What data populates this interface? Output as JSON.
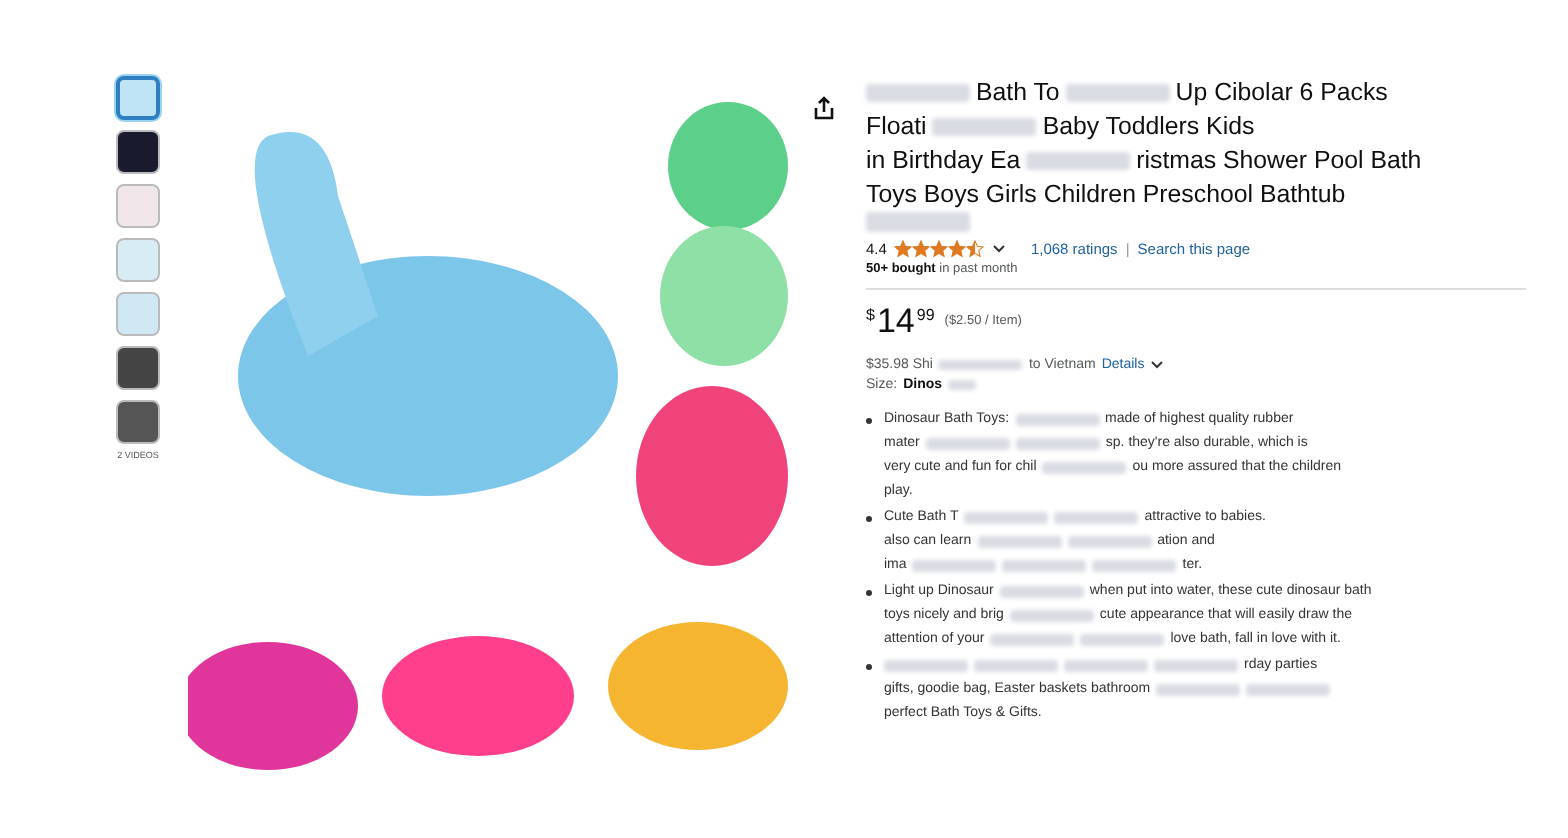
{
  "thumbnails": [
    {
      "selected": true
    },
    {
      "selected": false
    },
    {
      "selected": false
    },
    {
      "selected": false
    },
    {
      "selected": false
    },
    {
      "selected": false
    },
    {
      "selected": false
    }
  ],
  "videos_label": "2 VIDEOS",
  "title_lines": [
    [
      {
        "kind": "redacted"
      },
      {
        "kind": "text",
        "text": "Bath To"
      },
      {
        "kind": "redacted"
      },
      {
        "kind": "text",
        "text": "Up Cibolar 6 Packs"
      }
    ],
    [
      {
        "kind": "text",
        "text": "Floati"
      },
      {
        "kind": "redacted"
      },
      {
        "kind": "text",
        "text": "Baby Toddlers Kids"
      }
    ],
    [
      {
        "kind": "text",
        "text": "in Birthday Ea"
      },
      {
        "kind": "redacted"
      },
      {
        "kind": "text",
        "text": "ristmas Shower Pool Bath"
      }
    ],
    [
      {
        "kind": "text",
        "text": "Toys Boys Girls Children Preschool Bathtub"
      }
    ],
    [
      {
        "kind": "redacted"
      }
    ]
  ],
  "rating": {
    "value": "4.4",
    "stars": 4.5,
    "ratings": "1,068 ratings",
    "separator": "|",
    "search_link": "Search this page"
  },
  "bought": "**50+ bought** in past month",
  "price": {
    "currency": "$",
    "whole": "14",
    "fraction": "99",
    "unit_price": "($2.50 / Item)"
  },
  "shipping": [
    {
      "kind": "text",
      "text": "$35.98 Shi"
    },
    {
      "kind": "redacted"
    },
    {
      "kind": "text",
      "text": "to Vietnam"
    },
    {
      "kind": "link",
      "text": "Details"
    }
  ],
  "size": {
    "label": "Size:",
    "value": "Dinos"
  },
  "bullets": [
    {
      "lines": [
        [
          {
            "kind": "text",
            "text": "Dinosaur Bath Toys:"
          },
          {
            "kind": "redacted"
          },
          {
            "kind": "text",
            "text": "made of highest quality rubber"
          }
        ],
        [
          {
            "kind": "text",
            "text": "mater"
          },
          {
            "kind": "redacted"
          },
          {
            "kind": "redacted"
          },
          {
            "kind": "text",
            "text": "sp. they're also durable, which is"
          }
        ],
        [
          {
            "kind": "text",
            "text": "very cute and fun for chil"
          },
          {
            "kind": "redacted"
          },
          {
            "kind": "text",
            "text": "ou more assured that the children"
          }
        ],
        [
          {
            "kind": "text",
            "text": "play."
          }
        ]
      ]
    },
    {
      "lines": [
        [
          {
            "kind": "text",
            "text": "Cute Bath T"
          },
          {
            "kind": "redacted"
          },
          {
            "kind": "redacted"
          },
          {
            "kind": "text",
            "text": "attractive to babies."
          }
        ],
        [
          {
            "kind": "text",
            "text": "also can learn"
          },
          {
            "kind": "redacted"
          },
          {
            "kind": "redacted"
          },
          {
            "kind": "text",
            "text": "ation and"
          }
        ],
        [
          {
            "kind": "text",
            "text": "ima"
          },
          {
            "kind": "redacted"
          },
          {
            "kind": "redacted"
          },
          {
            "kind": "redacted"
          },
          {
            "kind": "text",
            "text": "ter."
          }
        ]
      ]
    },
    {
      "lines": [
        [
          {
            "kind": "text",
            "text": "Light up Dinosaur"
          },
          {
            "kind": "redacted"
          },
          {
            "kind": "text",
            "text": "when put into water, these cute dinosaur bath"
          }
        ],
        [
          {
            "kind": "text",
            "text": "toys nicely and brig"
          },
          {
            "kind": "redacted"
          },
          {
            "kind": "text",
            "text": "cute appearance that will easily draw the"
          }
        ],
        [
          {
            "kind": "text",
            "text": "attention of your"
          },
          {
            "kind": "redacted"
          },
          {
            "kind": "redacted"
          },
          {
            "kind": "text",
            "text": "love bath, fall in love with it."
          }
        ]
      ]
    },
    {
      "lines": [
        [
          {
            "kind": "redacted"
          },
          {
            "kind": "redacted"
          },
          {
            "kind": "redacted"
          },
          {
            "kind": "redacted"
          },
          {
            "kind": "text",
            "text": "rday parties"
          }
        ],
        [
          {
            "kind": "text",
            "text": "gifts, goodie bag, Easter baskets bathroom"
          },
          {
            "kind": "redacted"
          },
          {
            "kind": "redacted"
          }
        ],
        [
          {
            "kind": "text",
            "text": "perfect Bath Toys & Gifts."
          }
        ]
      ]
    }
  ]
}
